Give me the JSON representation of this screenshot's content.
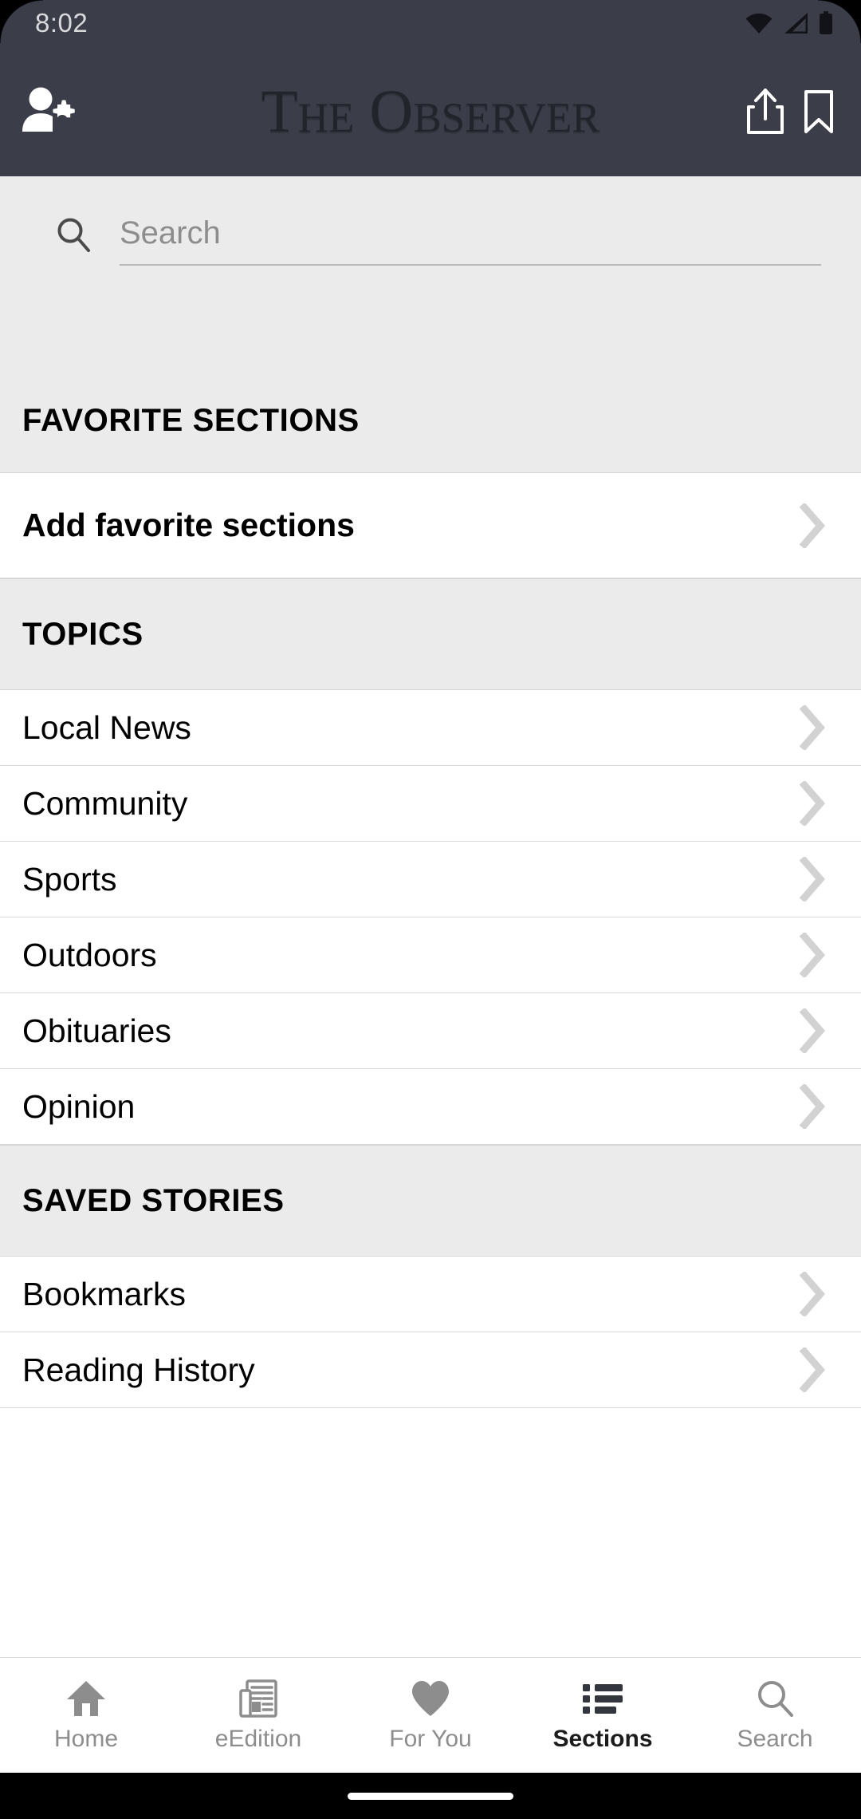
{
  "status_bar": {
    "time": "8:02",
    "icons": [
      "wifi-icon",
      "cellular-signal-icon",
      "battery-icon"
    ]
  },
  "app_bar": {
    "masthead": "The Observer",
    "left_icon": "profile-settings-icon",
    "right_icons": [
      "share-icon",
      "bookmark-icon"
    ]
  },
  "search": {
    "placeholder": "Search",
    "value": "",
    "icon": "search-icon"
  },
  "sections": [
    {
      "header": "FAVORITE SECTIONS",
      "rows": [
        {
          "label": "Add favorite sections",
          "bold": true,
          "chevron": "chevron-right-icon"
        }
      ]
    },
    {
      "header": "TOPICS",
      "rows": [
        {
          "label": "Local News",
          "bold": false,
          "chevron": "chevron-right-icon"
        },
        {
          "label": "Community",
          "bold": false,
          "chevron": "chevron-right-icon"
        },
        {
          "label": "Sports",
          "bold": false,
          "chevron": "chevron-right-icon"
        },
        {
          "label": "Outdoors",
          "bold": false,
          "chevron": "chevron-right-icon"
        },
        {
          "label": "Obituaries",
          "bold": false,
          "chevron": "chevron-right-icon"
        },
        {
          "label": "Opinion",
          "bold": false,
          "chevron": "chevron-right-icon"
        }
      ]
    },
    {
      "header": "SAVED STORIES",
      "rows": [
        {
          "label": "Bookmarks",
          "bold": false,
          "chevron": "chevron-right-icon"
        },
        {
          "label": "Reading History",
          "bold": false,
          "chevron": "chevron-right-icon"
        }
      ]
    }
  ],
  "bottom_nav": {
    "items": [
      {
        "label": "Home",
        "icon": "home-icon",
        "active": false
      },
      {
        "label": "eEdition",
        "icon": "newspaper-icon",
        "active": false
      },
      {
        "label": "For You",
        "icon": "heart-icon",
        "active": false
      },
      {
        "label": "Sections",
        "icon": "list-icon",
        "active": true
      },
      {
        "label": "Search",
        "icon": "search-icon",
        "active": false
      }
    ]
  },
  "colors": {
    "header_bg": "#3b3e48",
    "band_bg": "#ebebeb",
    "row_bg": "#ffffff",
    "divider": "#d9d9d9",
    "muted_text": "#8d8d8d",
    "active_text": "#1c1c1c",
    "chevron": "#d2d2d2"
  }
}
